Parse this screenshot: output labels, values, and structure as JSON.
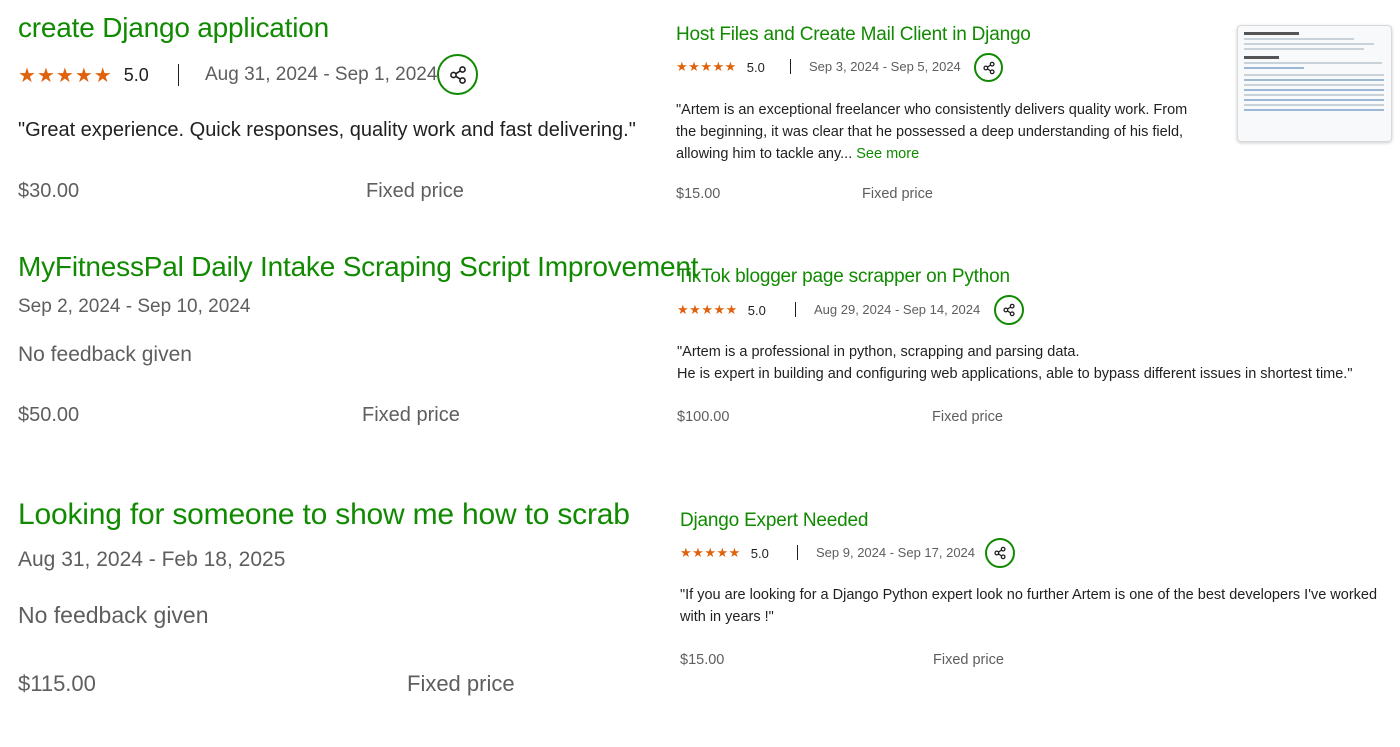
{
  "left": {
    "items": [
      {
        "title": "create Django application",
        "rating": "5.0",
        "dates": "Aug 31, 2024 - Sep 1, 2024",
        "feedback": "\"Great experience. Quick responses, quality work and fast delivering.\"",
        "price": "$30.00",
        "price_type": "Fixed price"
      },
      {
        "title": "MyFitnessPal Daily Intake Scraping Script Improvement",
        "dates": "Sep 2, 2024 - Sep 10, 2024",
        "feedback": "No feedback given",
        "price": "$50.00",
        "price_type": "Fixed price"
      },
      {
        "title": "Looking for someone to show me how to scrab",
        "dates": "Aug 31, 2024 - Feb 18, 2025",
        "feedback": "No feedback given",
        "price": "$115.00",
        "price_type": "Fixed price"
      }
    ]
  },
  "right": {
    "items": [
      {
        "title": "Host Files and Create Mail Client in Django",
        "rating": "5.0",
        "dates": "Sep 3, 2024 - Sep 5, 2024",
        "feedback_lines": [
          "\"Artem is an exceptional freelancer who consistently delivers quality work. From",
          "the beginning, it was clear that he possessed a deep understanding of his field,",
          "allowing him to tackle any..."
        ],
        "see_more": "See more",
        "price": "$15.00",
        "price_type": "Fixed price"
      },
      {
        "title": "TikTok blogger page scrapper on Python",
        "rating": "5.0",
        "dates": "Aug 29, 2024 - Sep 14, 2024",
        "feedback_lines": [
          "\"Artem is a professional in python, scrapping and parsing data.",
          "He is expert in building and configuring web applications, able to bypass different issues in shortest time.\""
        ],
        "price": "$100.00",
        "price_type": "Fixed price"
      },
      {
        "title": "Django Expert Needed",
        "rating": "5.0",
        "dates": "Sep 9, 2024 - Sep 17, 2024",
        "feedback_lines": [
          "\"If you are looking for a Django Python expert look no further Artem is one of the best developers I've worked",
          "with in years !\""
        ],
        "price": "$15.00",
        "price_type": "Fixed price"
      }
    ]
  },
  "icons": {
    "star": "star-icon",
    "share": "share-icon"
  },
  "colors": {
    "title_green": "#108a00",
    "star_orange": "#e0620d",
    "text": "#1f1f1f",
    "muted": "#5e5e5e"
  }
}
